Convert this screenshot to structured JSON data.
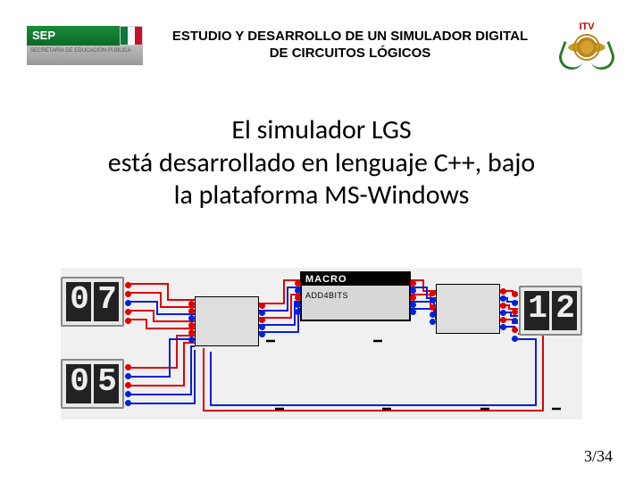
{
  "header": {
    "sep_label": "SEP",
    "sep_sub": "SECRETARÍA DE EDUCACIÓN PÚBLICA",
    "title_line1": "ESTUDIO Y DESARROLLO DE UN SIMULADOR DIGITAL",
    "title_line2": "DE CIRCUITOS LÓGICOS",
    "itv_label": "ITV"
  },
  "body": {
    "line1": "El simulador LGS",
    "line2": "está desarrollado en lenguaje C++, bajo",
    "line3": "la plataforma MS-Windows"
  },
  "diagram": {
    "display_top_left": "07",
    "display_bottom_left": "05",
    "display_right": "12",
    "macro_title": "MACRO",
    "macro_sub": "ADD4BITS"
  },
  "footer": {
    "page": "3/34"
  },
  "colors": {
    "wire_red": "#e00000",
    "wire_blue": "#0020e0",
    "wire_black": "#000000"
  }
}
